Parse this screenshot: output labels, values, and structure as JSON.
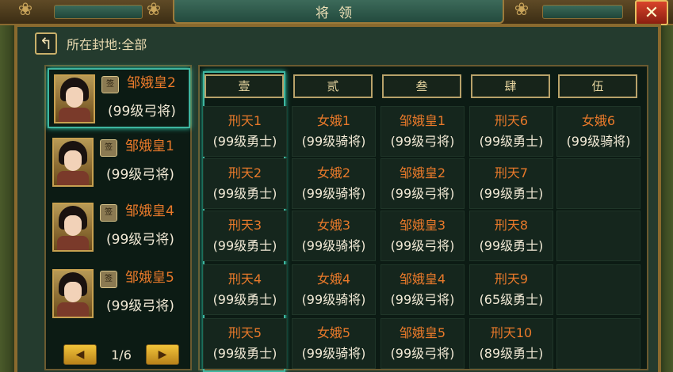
{
  "title": "将领",
  "fief_label": "所在封地:全部",
  "pager": {
    "text": "1/6"
  },
  "lords": [
    {
      "name": "邹娥皇2",
      "level": "(99级弓将)",
      "tag": "签"
    },
    {
      "name": "邹娥皇1",
      "level": "(99级弓将)",
      "tag": "签"
    },
    {
      "name": "邹娥皇4",
      "level": "(99级弓将)",
      "tag": "签"
    },
    {
      "name": "邹娥皇5",
      "level": "(99级弓将)",
      "tag": "签"
    }
  ],
  "columns": [
    {
      "header": "壹",
      "cells": [
        {
          "name": "刑天1",
          "level": "(99级勇士)"
        },
        {
          "name": "刑天2",
          "level": "(99级勇士)"
        },
        {
          "name": "刑天3",
          "level": "(99级勇士)"
        },
        {
          "name": "刑天4",
          "level": "(99级勇士)"
        },
        {
          "name": "刑天5",
          "level": "(99级勇士)"
        }
      ]
    },
    {
      "header": "贰",
      "cells": [
        {
          "name": "女娥1",
          "level": "(99级骑将)"
        },
        {
          "name": "女娥2",
          "level": "(99级骑将)"
        },
        {
          "name": "女娥3",
          "level": "(99级骑将)"
        },
        {
          "name": "女娥4",
          "level": "(99级骑将)"
        },
        {
          "name": "女娥5",
          "level": "(99级骑将)"
        }
      ]
    },
    {
      "header": "叁",
      "cells": [
        {
          "name": "邹娥皇1",
          "level": "(99级弓将)"
        },
        {
          "name": "邹娥皇2",
          "level": "(99级弓将)"
        },
        {
          "name": "邹娥皇3",
          "level": "(99级弓将)"
        },
        {
          "name": "邹娥皇4",
          "level": "(99级弓将)"
        },
        {
          "name": "邹娥皇5",
          "level": "(99级弓将)"
        }
      ]
    },
    {
      "header": "肆",
      "cells": [
        {
          "name": "刑天6",
          "level": "(99级勇士)"
        },
        {
          "name": "刑天7",
          "level": "(99级勇士)"
        },
        {
          "name": "刑天8",
          "level": "(99级勇士)"
        },
        {
          "name": "刑天9",
          "level": "(65级勇士)"
        },
        {
          "name": "刑天10",
          "level": "(89级勇士)"
        }
      ]
    },
    {
      "header": "伍",
      "cells": [
        {
          "name": "女娥6",
          "level": "(99级骑将)"
        },
        {
          "name": "",
          "level": ""
        },
        {
          "name": "",
          "level": ""
        },
        {
          "name": "",
          "level": ""
        },
        {
          "name": "",
          "level": ""
        }
      ]
    }
  ],
  "icons": {
    "close": "close-icon",
    "back": "back-arrow-icon",
    "prev": "triangle-left-icon",
    "next": "triangle-right-icon"
  },
  "colors": {
    "name": "#e8792a",
    "level": "#f2ead6",
    "highlight": "#3fb6a0"
  }
}
